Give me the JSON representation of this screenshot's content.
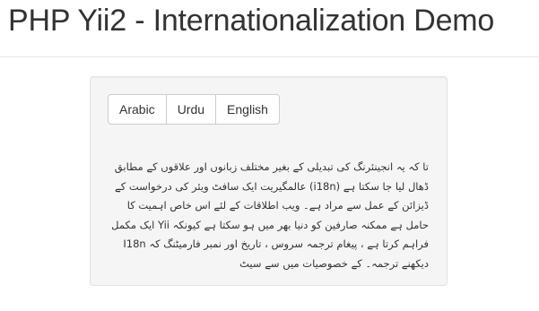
{
  "header": {
    "title": "PHP Yii2 - Internationalization Demo"
  },
  "language_switcher": {
    "buttons": [
      {
        "label": "Arabic"
      },
      {
        "label": "Urdu"
      },
      {
        "label": "English"
      }
    ]
  },
  "content": {
    "text": "تا کہ یہ انجینئرنگ کی تبدیلی کے بغیر مختلف زبانوں اور علاقوں کے مطابق ڈھال لیا جا سکتا ہے (i18n) عالمگیریت ایک سافٹ ویئر کی درخواست کے ڈیزائن کے عمل سے مراد ہے۔ ویب اطلاقات کے لئے اس خاص اہمیت کا حامل ہے ممکنہ صارفین کو دنیا بھر میں ہو سکتا ہے کیونکہ Yii ایک مکمل فراہم کرتا ہے ، پیغام ترجمہ سروس ، تاریخ اور نمبر فارمیٹنگ کہ I18n دیکھنے ترجمہ۔ کے خصوصیات میں سے سیٹ"
  }
}
